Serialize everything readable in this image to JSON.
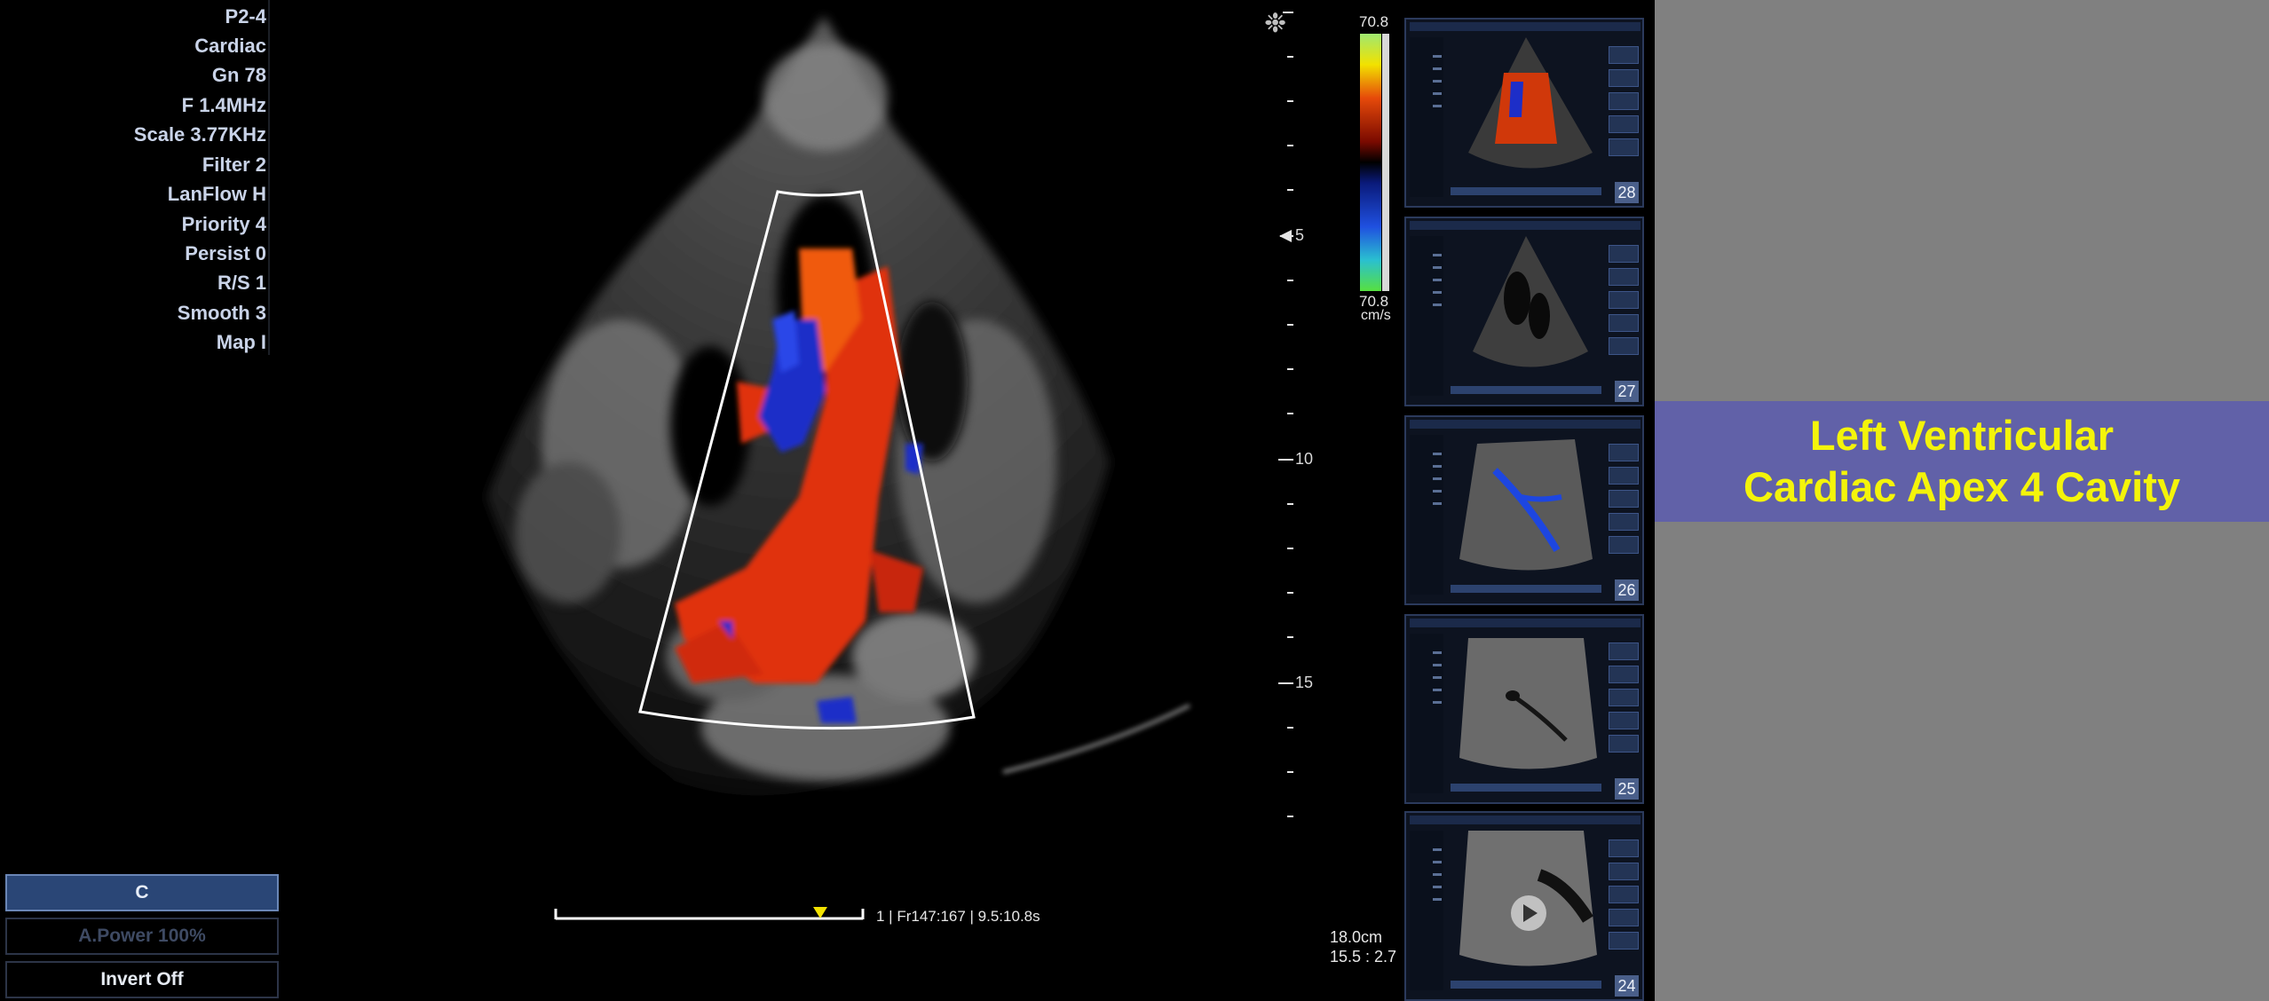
{
  "params": [
    "P2-4",
    "Cardiac",
    "Gn 78",
    "F 1.4MHz",
    "Scale 3.77KHz",
    "Filter 2",
    "LanFlow H",
    "Priority 4",
    "Persist 0",
    "R/S 1",
    "Smooth 3",
    "Map I"
  ],
  "soft_buttons": {
    "c": "C",
    "apower": "A.Power 100%",
    "invert": "Invert  Off"
  },
  "depth_labels": [
    "5",
    "10",
    "15"
  ],
  "color_scale": {
    "top": "70.8",
    "bottom": "70.8",
    "unit": "cm/s"
  },
  "depth_readout": [
    "18.0cm",
    "15.5 : 2.7"
  ],
  "cine_info": "1 | Fr147:167 | 9.5:10.8s",
  "thumbnails": [
    "28",
    "27",
    "26",
    "25",
    "24"
  ],
  "title": [
    "Left Ventricular",
    "Cardiac Apex 4 Cavity"
  ],
  "colors": {
    "banner": "#6161a8",
    "title_text": "#f4f40a",
    "right_panel": "#808080",
    "selected_button": "#2a4676"
  }
}
